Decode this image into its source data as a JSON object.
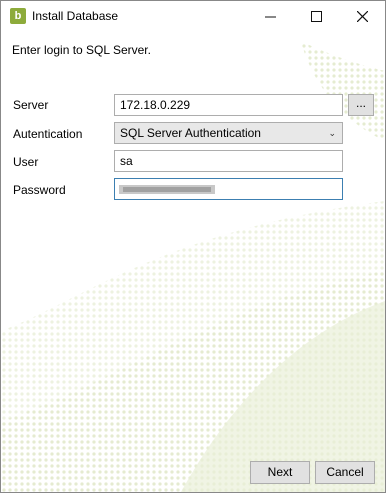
{
  "window": {
    "title": "Install Database",
    "app_icon_letter": "b"
  },
  "intro": "Enter login to SQL Server.",
  "form": {
    "server_label": "Server",
    "server_value": "172.18.0.229",
    "browse_label": "...",
    "auth_label": "Autentication",
    "auth_value": "SQL Server Authentication",
    "user_label": "User",
    "user_value": "sa",
    "password_label": "Password"
  },
  "buttons": {
    "next": "Next",
    "cancel": "Cancel"
  },
  "colors": {
    "accent": "#8dab3b",
    "decor": "#e3ead0"
  }
}
